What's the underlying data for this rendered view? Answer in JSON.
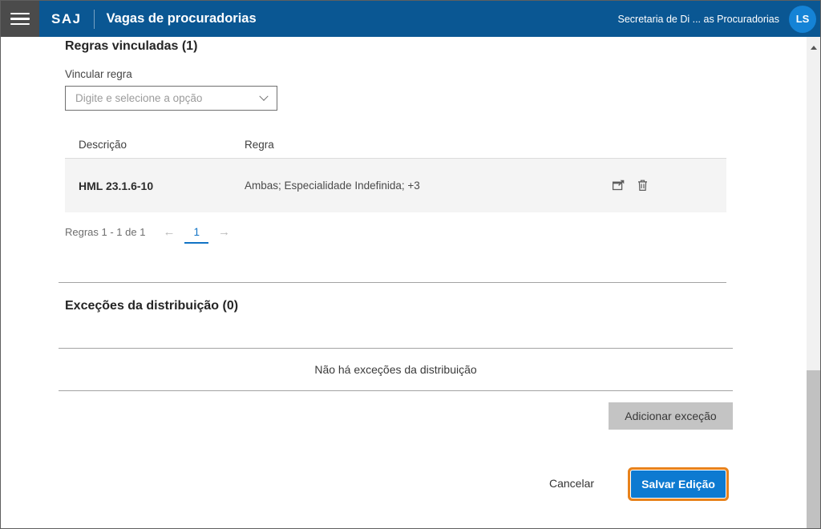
{
  "header": {
    "brand": "SAJ",
    "title": "Vagas de procuradorias",
    "user_context": "Secretaria de Di ... as Procuradorias",
    "avatar_initials": "LS"
  },
  "rules": {
    "section_title": "Regras vinculadas (1)",
    "field_label": "Vincular regra",
    "select_placeholder": "Digite e selecione a opção",
    "table": {
      "columns": [
        "Descrição",
        "Regra"
      ],
      "rows": [
        {
          "descricao": "HML 23.1.6-10",
          "regra": "Ambas; Especialidade Indefinida; +3"
        }
      ]
    },
    "pagination": {
      "summary": "Regras 1 - 1 de 1",
      "current_page": "1",
      "prev_glyph": "←",
      "next_glyph": "→"
    }
  },
  "exceptions": {
    "section_title": "Exceções da distribuição (0)",
    "empty_message": "Não há exceções da distribuição",
    "add_button_label": "Adicionar exceção"
  },
  "footer": {
    "cancel_label": "Cancelar",
    "save_label": "Salvar Edição"
  },
  "icons": {
    "row_action_1": "open-in-window-icon",
    "row_action_2": "trash-icon"
  },
  "colors": {
    "header_bg": "#0a5793",
    "menu_bg": "#4b4b4b",
    "avatar_bg": "#1583d6",
    "primary_button_bg": "#0d7ad1",
    "focus_ring": "#e8821c",
    "active_page": "#1173c5",
    "row_bg": "#f4f4f4",
    "disabled_button_bg": "#c4c4c4"
  }
}
